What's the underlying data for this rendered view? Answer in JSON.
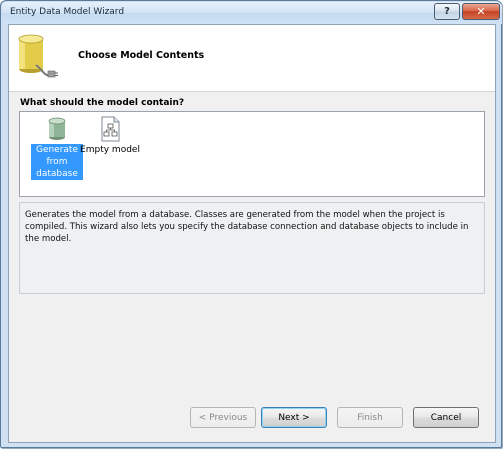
{
  "window": {
    "title": "Entity Data Model Wizard",
    "help_label": "?",
    "close_label": "✕"
  },
  "header": {
    "title": "Choose Model Contents"
  },
  "question": {
    "label": "What should the model contain?"
  },
  "choices": [
    {
      "label": "Generate from database",
      "selected": true,
      "icon": "database-icon"
    },
    {
      "label": "Empty model",
      "selected": false,
      "icon": "empty-model-icon"
    }
  ],
  "description": "Generates the model from a database. Classes are generated from the model when the project is compiled. This wizard also lets you specify the database connection and database objects to include in the model.",
  "buttons": {
    "previous": "< Previous",
    "next": "Next >",
    "finish": "Finish",
    "cancel": "Cancel"
  },
  "colors": {
    "selection": "#3399ff",
    "client_bg": "#f0f0f0",
    "frame": "#cfe0f2"
  }
}
